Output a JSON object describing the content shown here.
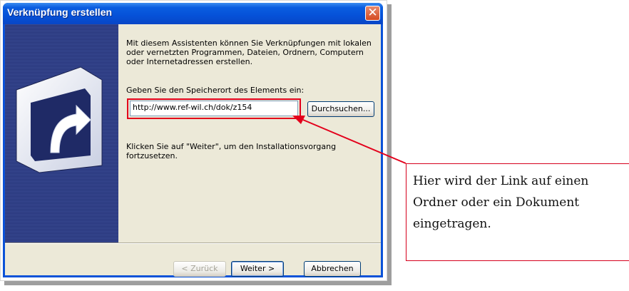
{
  "window": {
    "title": "Verknüpfung erstellen",
    "close_glyph": "✕"
  },
  "content": {
    "intro_text": "Mit diesem Assistenten können Sie Verknüpfungen mit lokalen oder vernetzten Programmen, Dateien, Ordnern, Computern oder Internetadressen erstellen.",
    "location_prompt": "Geben Sie den Speicherort des Elements ein:",
    "location_value": "http://www.ref-wil.ch/dok/z154",
    "browse_label": "Durchsuchen...",
    "hint_text": "Klicken Sie auf \"Weiter\", um den Installationsvorgang fortzusetzen."
  },
  "buttons": {
    "back_label": "< Zurück",
    "next_label": "Weiter >",
    "cancel_label": "Abbrechen"
  },
  "callout": {
    "text": "Hier wird der Link auf einen\nOrdner oder ein Dokument\neingetragen."
  },
  "colors": {
    "highlight": "#e3001b",
    "titlebar": "#0551d8",
    "dialog_face": "#ece9d8"
  },
  "icons": {
    "side_icon": "shortcut-arrow-icon",
    "close_icon": "close-icon"
  }
}
